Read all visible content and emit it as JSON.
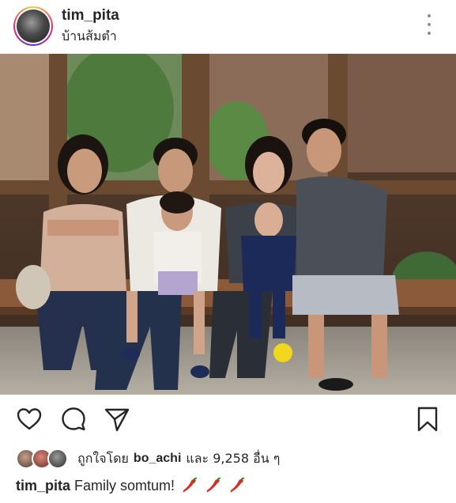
{
  "post": {
    "username": "tim_pita",
    "location": "บ้านส้มตำ"
  },
  "photo": {
    "description_icon": "family-photo"
  },
  "actions": {
    "like_icon": "heart-icon",
    "comment_icon": "comment-icon",
    "share_icon": "paper-plane-icon",
    "save_icon": "bookmark-icon"
  },
  "likes": {
    "prefix": "ถูกใจโดย",
    "user": "bo_achi",
    "suffix": "และ 9,258 อื่น ๆ"
  },
  "caption": {
    "user": "tim_pita",
    "text": "Family somtum!"
  },
  "colors": {
    "accent": "#262626",
    "pepper": "#d62d20"
  }
}
